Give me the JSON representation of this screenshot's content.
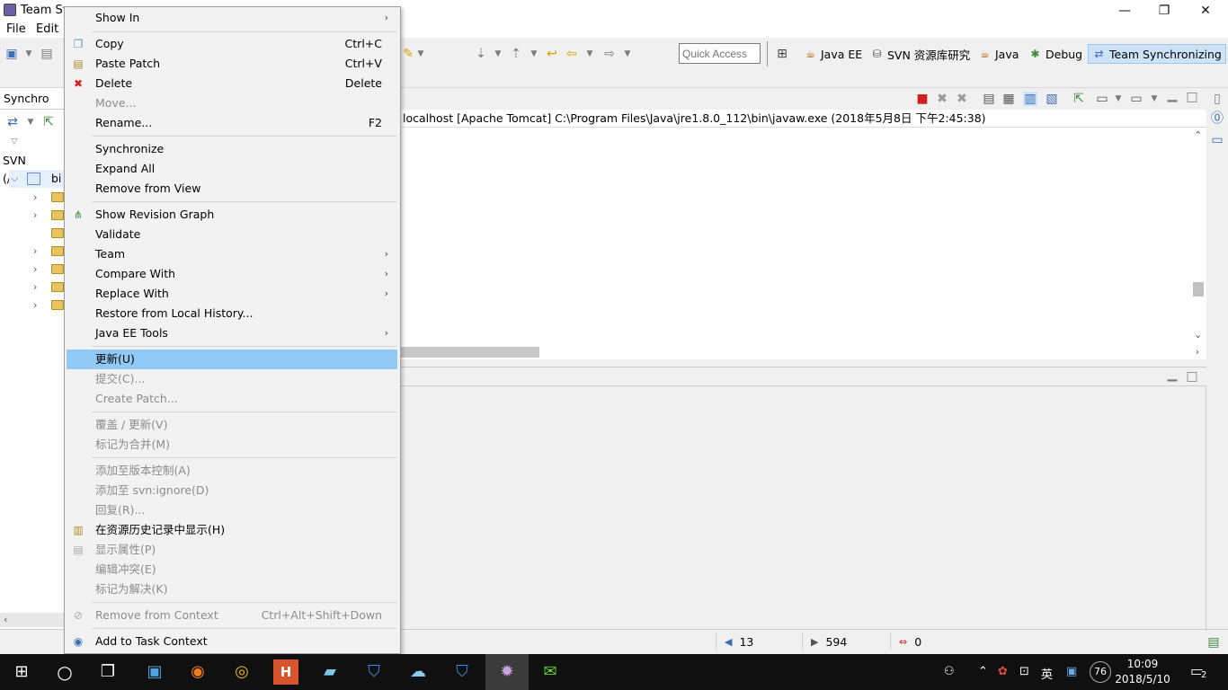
{
  "window": {
    "title": "Team Sy",
    "minimize": "—",
    "maximize": "❐",
    "close": "✕"
  },
  "menubar": {
    "items": [
      "File",
      "Edit"
    ]
  },
  "toolbar": {
    "quick_access_placeholder": "Quick Access",
    "perspectives": [
      {
        "label": "Java EE",
        "icon": "java-ee-icon"
      },
      {
        "label": "SVN 资源库研究",
        "icon": "svn-icon"
      },
      {
        "label": "Java",
        "icon": "java-icon"
      },
      {
        "label": "Debug",
        "icon": "debug-icon"
      },
      {
        "label": "Team Synchronizing",
        "icon": "team-sync-icon",
        "active": true
      }
    ]
  },
  "left_panel": {
    "tab_label": "Synchro",
    "svn_label": "SVN (/bisor",
    "project_label": "bi"
  },
  "console": {
    "title": "localhost [Apache Tomcat] C:\\Program Files\\Java\\jre1.8.0_112\\bin\\javaw.exe (2018年5月8日 下午2:45:38)"
  },
  "context_menu": {
    "items": [
      {
        "label": "Show In",
        "submenu": true
      },
      {
        "label": "Copy",
        "accel": "Ctrl+C",
        "icon": "copy-icon"
      },
      {
        "label": "Paste Patch",
        "accel": "Ctrl+V",
        "icon": "paste-icon"
      },
      {
        "label": "Delete",
        "accel": "Delete",
        "icon": "delete-icon"
      },
      {
        "label": "Move...",
        "disabled": true
      },
      {
        "label": "Rename...",
        "accel": "F2"
      },
      {
        "label": "Synchronize"
      },
      {
        "label": "Expand All"
      },
      {
        "label": "Remove from View"
      },
      {
        "label": "Show Revision Graph",
        "icon": "revision-graph-icon"
      },
      {
        "label": "Validate"
      },
      {
        "label": "Team",
        "submenu": true
      },
      {
        "label": "Compare With",
        "submenu": true
      },
      {
        "label": "Replace With",
        "submenu": true
      },
      {
        "label": "Restore from Local History..."
      },
      {
        "label": "Java EE Tools",
        "submenu": true
      },
      {
        "label": "更新(U)",
        "selected": true
      },
      {
        "label": "提交(C)...",
        "disabled": true
      },
      {
        "label": "Create Patch...",
        "disabled": true
      },
      {
        "label": "覆盖 / 更新(V)",
        "disabled": true
      },
      {
        "label": "标记为合并(M)",
        "disabled": true
      },
      {
        "label": "添加至版本控制(A)",
        "disabled": true
      },
      {
        "label": "添加至 svn:ignore(D)",
        "disabled": true
      },
      {
        "label": "回复(R)...",
        "disabled": true
      },
      {
        "label": "在资源历史记录中显示(H)",
        "icon": "history-icon"
      },
      {
        "label": "显示属性(P)",
        "disabled": true,
        "icon": "properties-icon"
      },
      {
        "label": "编辑冲突(E)",
        "disabled": true
      },
      {
        "label": "标记为解决(K)",
        "disabled": true
      },
      {
        "label": "Remove from Context",
        "accel": "Ctrl+Alt+Shift+Down",
        "disabled": true,
        "icon": "remove-context-icon"
      },
      {
        "label": "Add to Task Context",
        "icon": "task-context-icon"
      }
    ]
  },
  "statusbar": {
    "incoming": "13",
    "outgoing": "594",
    "conflicts": "0"
  },
  "taskbar": {
    "time": "10:09",
    "date": "2018/5/10",
    "ime": "英",
    "battery": "76",
    "notifications": "2"
  }
}
